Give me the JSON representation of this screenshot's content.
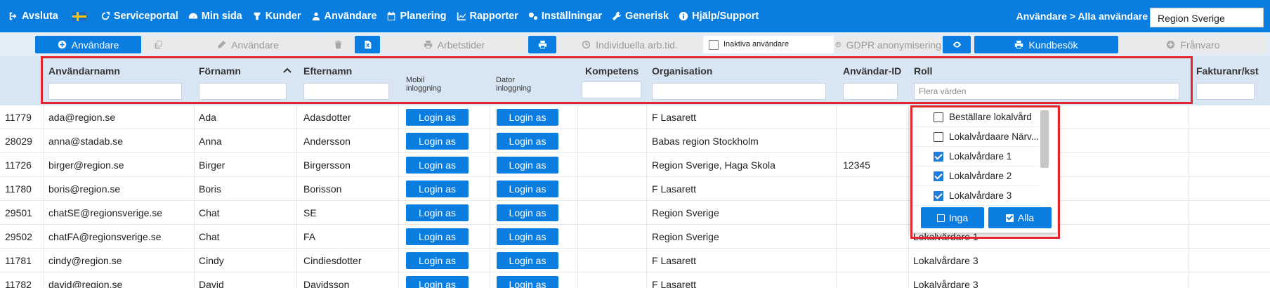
{
  "nav": {
    "items": [
      {
        "label": "Avsluta",
        "icon": "logout-icon"
      },
      {
        "label": "",
        "icon": "swedish-flag-icon"
      },
      {
        "label": "Serviceportal",
        "icon": "service-icon"
      },
      {
        "label": "Min sida",
        "icon": "dashboard-icon"
      },
      {
        "label": "Kunder",
        "icon": "customer-icon"
      },
      {
        "label": "Användare",
        "icon": "user-icon"
      },
      {
        "label": "Planering",
        "icon": "calendar-icon"
      },
      {
        "label": "Rapporter",
        "icon": "chart-icon"
      },
      {
        "label": "Inställningar",
        "icon": "gears-icon"
      },
      {
        "label": "Generisk",
        "icon": "wrench-icon"
      },
      {
        "label": "Hjälp/Support",
        "icon": "info-icon"
      }
    ],
    "breadcrumb": "Användare > Alla användare",
    "region_select": "Region Sverige"
  },
  "toolbar": {
    "add_user": "Användare",
    "edit_user": "Användare",
    "work_times": "Arbetstider",
    "individual_work_times": "Individuella arb.tid.",
    "inactive_users": "Inaktiva användare",
    "gdpr": "GDPR anonymisering",
    "customer_visit": "Kundbesök",
    "absence": "Frånvaro"
  },
  "columns": {
    "username": "Användarnamn",
    "firstname": "Förnamn",
    "lastname": "Efternamn",
    "mobile_login": "Mobil inloggning",
    "computer_login": "Dator inloggning",
    "competence": "Kompetens",
    "organisation": "Organisation",
    "user_id": "Användar-ID",
    "role": "Roll",
    "invoice": "Fakturanr/kst"
  },
  "filters": {
    "role_placeholder": "Flera värden"
  },
  "login_label": "Login as",
  "rows": [
    {
      "id": "11779",
      "username": "ada@region.se",
      "firstname": "Ada",
      "lastname": "Adasdotter",
      "organisation": "F Lasarett",
      "user_id": "",
      "role": ""
    },
    {
      "id": "28029",
      "username": "anna@stadab.se",
      "firstname": "Anna",
      "lastname": "Andersson",
      "organisation": "Babas region Stockholm",
      "user_id": "",
      "role": ""
    },
    {
      "id": "11726",
      "username": "birger@region.se",
      "firstname": "Birger",
      "lastname": "Birgersson",
      "organisation": "Region Sverige, Haga Skola",
      "user_id": "12345",
      "role": ""
    },
    {
      "id": "11780",
      "username": "boris@region.se",
      "firstname": "Boris",
      "lastname": "Borisson",
      "organisation": "F Lasarett",
      "user_id": "",
      "role": ""
    },
    {
      "id": "29501",
      "username": "chatSE@regionsverige.se",
      "firstname": "Chat",
      "lastname": "SE",
      "organisation": "Region Sverige",
      "user_id": "",
      "role": ""
    },
    {
      "id": "29502",
      "username": "chatFA@regionsverige.se",
      "firstname": "Chat",
      "lastname": "FA",
      "organisation": "Region Sverige",
      "user_id": "",
      "role": "Lokalvårdare 1"
    },
    {
      "id": "11781",
      "username": "cindy@region.se",
      "firstname": "Cindy",
      "lastname": "Cindiesdotter",
      "organisation": "F Lasarett",
      "user_id": "",
      "role": "Lokalvårdare 3"
    },
    {
      "id": "11782",
      "username": "david@region.se",
      "firstname": "David",
      "lastname": "Davidsson",
      "organisation": "F Lasarett",
      "user_id": "",
      "role": "Lokalvårdare 3"
    }
  ],
  "role_dropdown": {
    "options": [
      {
        "label": "Beställare lokalvård",
        "checked": false
      },
      {
        "label": "Lokalvårdaare Närv...",
        "checked": false
      },
      {
        "label": "Lokalvårdare 1",
        "checked": true
      },
      {
        "label": "Lokalvårdare 2",
        "checked": true
      },
      {
        "label": "Lokalvårdare 3",
        "checked": true
      }
    ],
    "none_label": "Inga",
    "all_label": "Alla"
  },
  "colors": {
    "primary": "#0a7ee0",
    "header_bg": "#d8e6f3",
    "highlight": "#e3262e"
  }
}
